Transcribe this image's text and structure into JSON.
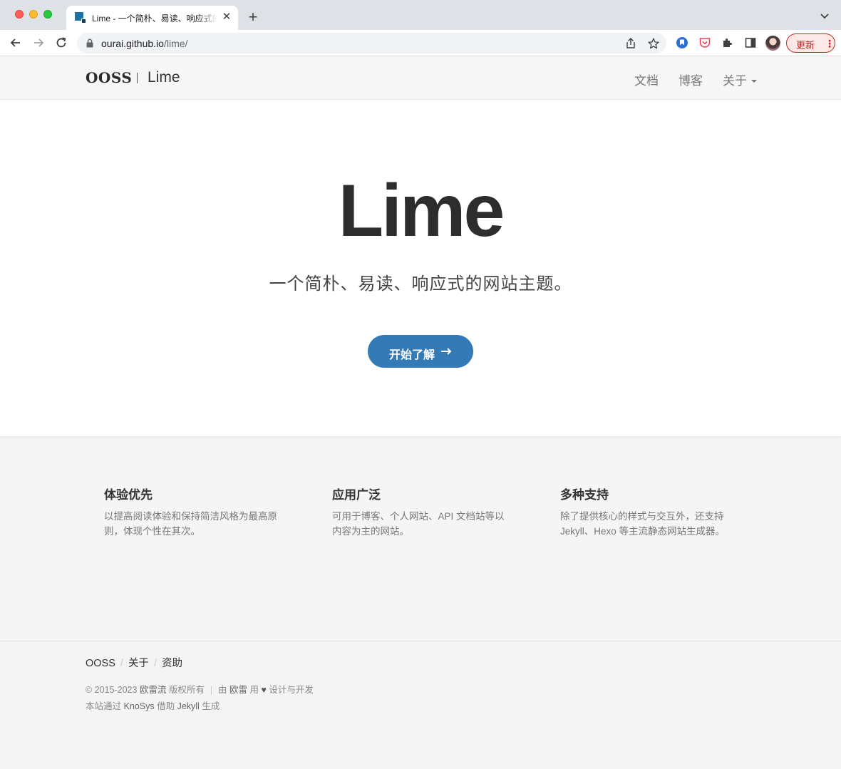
{
  "browser": {
    "tab_title": "Lime - 一个简朴、易读、响应式的网站主题。",
    "tab_close": "✕",
    "new_tab": "+",
    "url_host": "ourai.github.io",
    "url_path": "/lime/",
    "update_label": "更新",
    "menu_dots": "⋮"
  },
  "header": {
    "brand_org": "OOSS",
    "brand_name": "Lime",
    "nav": {
      "docs": "文档",
      "blog": "博客",
      "about": "关于"
    }
  },
  "hero": {
    "title": "Lime",
    "subtitle": "一个简朴、易读、响应式的网站主题。",
    "cta_label": "开始了解"
  },
  "features": [
    {
      "title": "体验优先",
      "desc": "以提高阅读体验和保持简洁风格为最高原则，体现个性在其次。"
    },
    {
      "title": "应用广泛",
      "desc": "可用于博客、个人网站、API 文档站等以内容为主的网站。"
    },
    {
      "title": "多种支持",
      "desc": "除了提供核心的样式与交互外，还支持 Jekyll、Hexo 等主流静态网站生成器。"
    }
  ],
  "footer": {
    "nav": [
      "OOSS",
      "关于",
      "资助"
    ],
    "slash": "/",
    "copyright_prefix": "© 2015-2023",
    "author": "欧雷流",
    "rights": "版权所有",
    "by": "由",
    "designer": "欧雷",
    "with": "用",
    "heart": "♥",
    "design_dev": "设计与开发",
    "built_prefix": "本站通过",
    "built_tool": "KnoSys",
    "built_mid": "借助",
    "built_engine": "Jekyll",
    "built_suffix": "生成"
  }
}
